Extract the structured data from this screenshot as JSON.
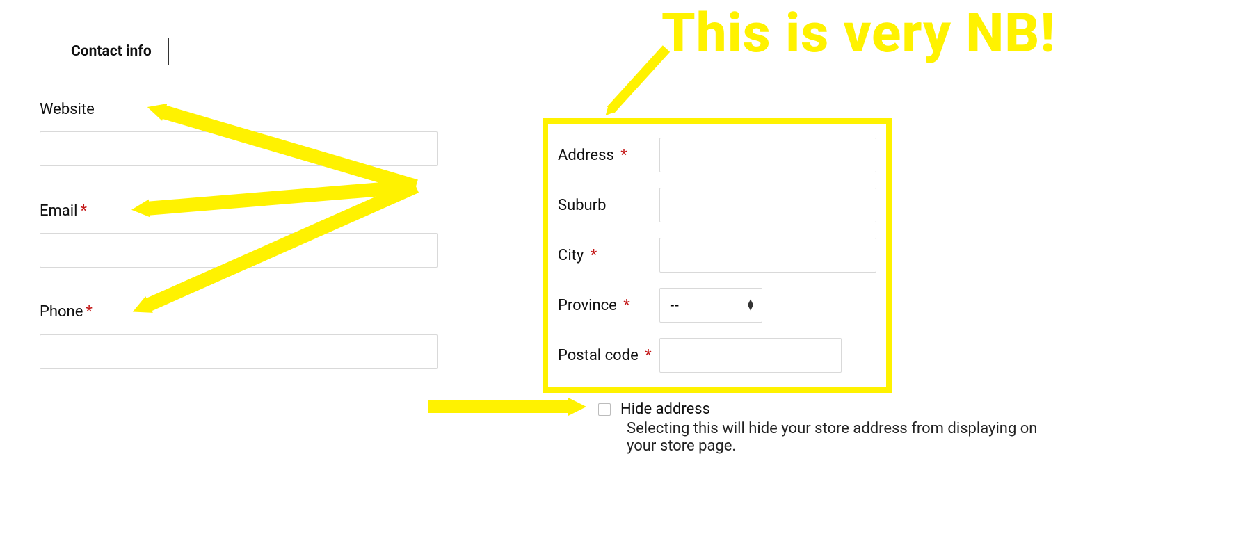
{
  "colors": {
    "highlight": "#fff200",
    "required": "#c31616"
  },
  "annotation": {
    "text": "This is very NB!"
  },
  "tabs": {
    "active": "Contact info"
  },
  "left": {
    "website": {
      "label": "Website",
      "required": false,
      "value": ""
    },
    "email": {
      "label": "Email",
      "required": true,
      "value": ""
    },
    "phone": {
      "label": "Phone",
      "required": true,
      "value": ""
    }
  },
  "address": {
    "address": {
      "label": "Address",
      "required": true,
      "value": ""
    },
    "suburb": {
      "label": "Suburb",
      "required": false,
      "value": ""
    },
    "city": {
      "label": "City",
      "required": true,
      "value": ""
    },
    "province": {
      "label": "Province",
      "required": true,
      "selected": "--"
    },
    "postal": {
      "label": "Postal code",
      "required": true,
      "value": ""
    }
  },
  "hide": {
    "label": "Hide address",
    "checked": false,
    "description": "Selecting this will hide your store address from displaying on your store page."
  }
}
